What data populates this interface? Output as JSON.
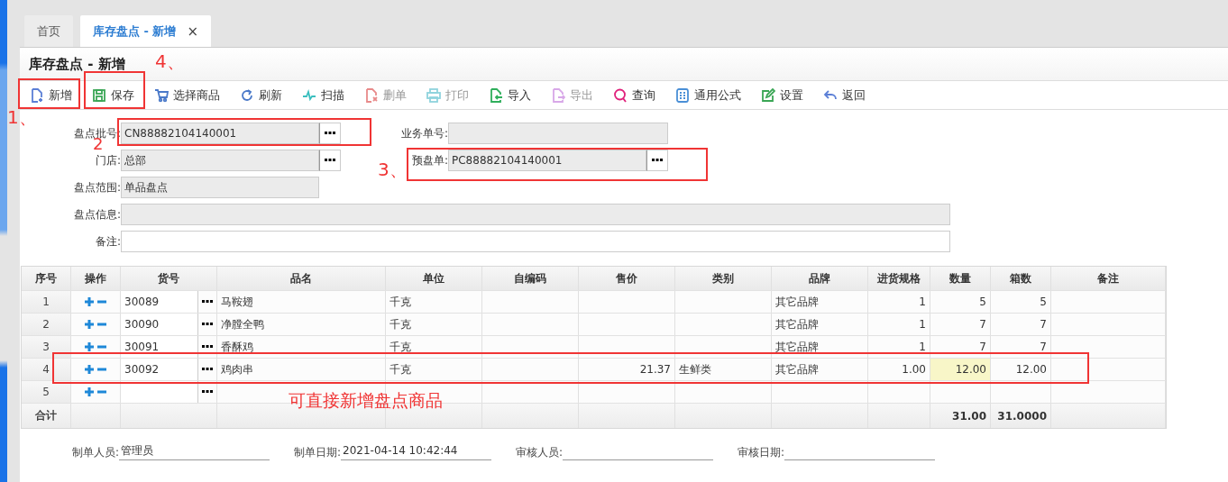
{
  "tabs": [
    {
      "label": "首页",
      "selected": false
    },
    {
      "label": "库存盘点 - 新增",
      "selected": true,
      "close": "×"
    }
  ],
  "page_title": "库存盘点 - 新增",
  "toolbar": [
    {
      "label": "新增",
      "disabled": false
    },
    {
      "label": "保存",
      "disabled": false
    },
    {
      "label": "选择商品",
      "disabled": false
    },
    {
      "label": "刷新",
      "disabled": false
    },
    {
      "label": "扫描",
      "disabled": false
    },
    {
      "label": "删单",
      "disabled": true
    },
    {
      "label": "打印",
      "disabled": true
    },
    {
      "label": "导入",
      "disabled": false
    },
    {
      "label": "导出",
      "disabled": true
    },
    {
      "label": "查询",
      "disabled": false
    },
    {
      "label": "通用公式",
      "disabled": false
    },
    {
      "label": "设置",
      "disabled": false
    },
    {
      "label": "返回",
      "disabled": false
    }
  ],
  "form": {
    "rows": [
      [
        {
          "label": "盘点批号:",
          "value": "CN88882104140001",
          "readonly": true,
          "picker": true
        },
        {
          "label": "业务单号:",
          "readonly": true,
          "picker": false
        }
      ],
      [
        {
          "label": "门店:",
          "value": "总部",
          "readonly": true,
          "picker": true
        },
        {
          "label": "预盘单:",
          "value": "PC88882104140001",
          "readonly": true,
          "picker": true
        }
      ],
      [
        {
          "label": "盘点范围:",
          "value": "单品盘点",
          "readonly": true,
          "picker": false
        }
      ],
      [
        {
          "label": "盘点信息:",
          "readonly": true,
          "picker": false,
          "wide": true
        }
      ],
      [
        {
          "label": "备注:",
          "readonly": false,
          "picker": false,
          "wide": true
        }
      ]
    ]
  },
  "table": {
    "columns": [
      "序号",
      "操作",
      "货号",
      "品名",
      "单位",
      "自编码",
      "售价",
      "类别",
      "品牌",
      "进货规格",
      "数量",
      "箱数",
      "备注"
    ],
    "rows": [
      {
        "seq": "1",
        "sku": "30089",
        "name": "马鞍翅",
        "unit": "千克",
        "brand": "其它品牌",
        "spec": "1",
        "qty": "5",
        "boxes": "5",
        "qty_active": false
      },
      {
        "seq": "2",
        "sku": "30090",
        "name": "净膛全鸭",
        "unit": "千克",
        "brand": "其它品牌",
        "spec": "1",
        "qty": "7",
        "boxes": "7",
        "qty_active": false
      },
      {
        "seq": "3",
        "sku": "30091",
        "name": "香酥鸡",
        "unit": "千克",
        "brand": "其它品牌",
        "spec": "1",
        "qty": "7",
        "boxes": "7",
        "qty_active": false
      },
      {
        "seq": "4",
        "sku": "30092",
        "name": "鸡肉串",
        "unit": "千克",
        "price": "21.37",
        "category": "生鲜类",
        "brand": "其它品牌",
        "spec": "1.00",
        "qty": "12.00",
        "boxes": "12.00",
        "qty_active": true
      },
      {
        "seq": "5",
        "qty_active": false
      }
    ],
    "total": {
      "label": "合计",
      "qty": "31.00",
      "boxes": "31.0000"
    }
  },
  "footer": [
    {
      "label": "制单人员:",
      "value": "管理员"
    },
    {
      "label": "制单日期:",
      "value": "2021-04-14 10:42:44"
    },
    {
      "label": "审核人员:"
    },
    {
      "label": "审核日期:"
    }
  ],
  "annotations": [
    {
      "kind": "box"
    },
    {
      "kind": "box"
    },
    {
      "kind": "text",
      "text": "4、"
    },
    {
      "kind": "text",
      "text": "1、"
    },
    {
      "kind": "box"
    },
    {
      "kind": "text",
      "text": "2"
    },
    {
      "kind": "text",
      "text": "3、"
    },
    {
      "kind": "box"
    },
    {
      "kind": "box"
    },
    {
      "kind": "text",
      "text": "可直接新增盘点商品"
    }
  ]
}
